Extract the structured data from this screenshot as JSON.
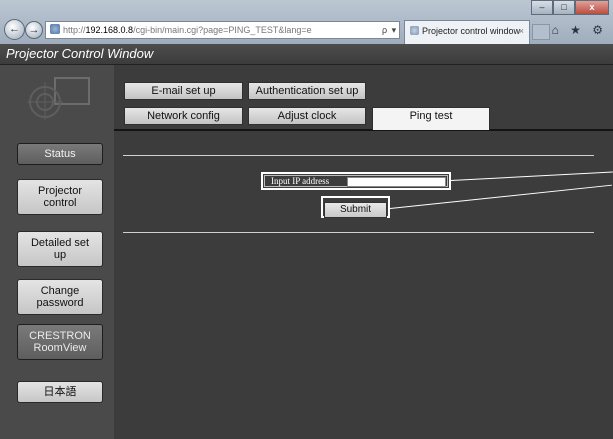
{
  "browser": {
    "url_host": "192.168.0.8",
    "url_rest": "/cgi-bin/main.cgi?page=PING_TEST&lang=e",
    "url_prefix": "http://",
    "address_tools": "ρ ▾ ≧ ♂ ✕",
    "tab_title": "Projector control window",
    "tab_close": "×",
    "window_minimize": "–",
    "window_maximize": "□",
    "window_close": "x",
    "toolbar_icons": "⌂ ★ ⚙",
    "back_icon": "←",
    "forward_icon": "→"
  },
  "page": {
    "title": "Projector Control Window"
  },
  "sidebar": {
    "items": [
      {
        "label": "Status"
      },
      {
        "label": "Projector control"
      },
      {
        "label": "Detailed set up"
      },
      {
        "label": "Change password"
      },
      {
        "label": "CRESTRON RoomView"
      },
      {
        "label": "日本語"
      }
    ]
  },
  "tabs": {
    "email": "E-mail set up",
    "authentication": "Authentication set up",
    "network": "Network config",
    "clock": "Adjust clock",
    "ping": "Ping test",
    "active": "Ping test"
  },
  "ping_form": {
    "ip_label": "Input IP address",
    "ip_value": "",
    "submit_label": "Submit"
  }
}
